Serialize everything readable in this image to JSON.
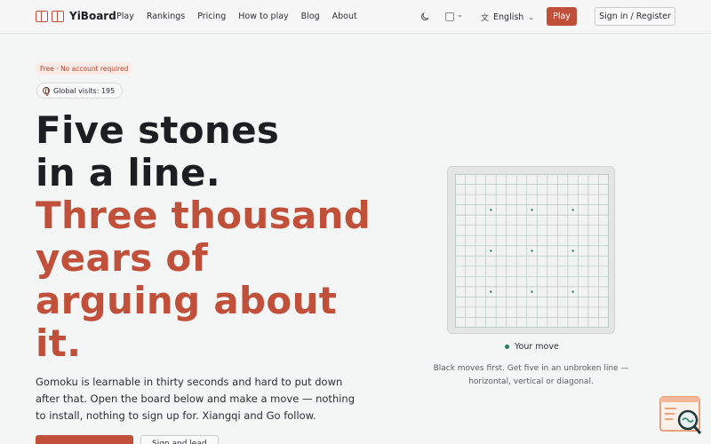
{
  "header": {
    "brand": "YiBoard",
    "nav": [
      {
        "label": "Play",
        "name": "nav-play"
      },
      {
        "label": "Rankings",
        "name": "nav-rankings"
      },
      {
        "label": "Pricing",
        "name": "nav-pricing"
      },
      {
        "label": "How to play",
        "name": "nav-how-to-play"
      },
      {
        "label": "Blog",
        "name": "nav-blog"
      },
      {
        "label": "About",
        "name": "nav-about"
      }
    ],
    "language": "English",
    "play_button": "Play",
    "signin_button": "Sign in / Register",
    "icons": [
      "moon-icon",
      "theme-square-icon",
      "translate-icon",
      "chevron-down-icon"
    ]
  },
  "hero": {
    "badge": "Free · No account required",
    "visits": "Global visits: 195",
    "headline_dark": [
      "Five stones",
      "in a line."
    ],
    "headline_accent": [
      "Three thousand",
      "years of",
      "arguing about",
      "it."
    ],
    "lede": "Gomoku is learnable in thirty seconds and hard to put down after that. Open the board below and make a move — nothing to install, nothing to sign up for. Xiangqi and Go follow.",
    "secondary_cta": "Sign and lead"
  },
  "board": {
    "size": 15,
    "turn_label": "Your move",
    "rules": "Black moves first. Get five in an unbroken line — horizontal, vertical or diagonal.",
    "star_points": [
      [
        3,
        3
      ],
      [
        3,
        7
      ],
      [
        3,
        11
      ],
      [
        7,
        3
      ],
      [
        7,
        7
      ],
      [
        7,
        11
      ],
      [
        11,
        3
      ],
      [
        11,
        7
      ],
      [
        11,
        11
      ]
    ]
  },
  "colors": {
    "accent": "#c0503a",
    "text": "#1c1f22",
    "turn_dot": "#2f7d60",
    "grid_line": "#b9c7c4"
  }
}
